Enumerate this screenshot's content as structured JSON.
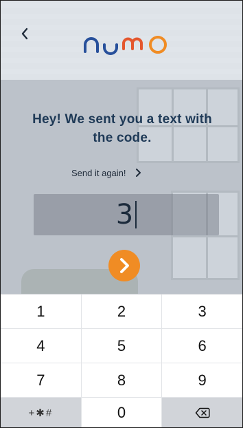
{
  "brand": {
    "logo_text": "numo",
    "colors": {
      "primary": "#1f3a57",
      "accent": "#f08c24",
      "logo_blue": "#27509b"
    }
  },
  "nav": {
    "back_icon": "chevron-left-icon"
  },
  "verification": {
    "headline": "Hey! We sent you a text with the code.",
    "resend_label": "Send it again!",
    "code_value": "3",
    "submit_icon": "chevron-right-icon"
  },
  "keypad": {
    "rows": [
      [
        "1",
        "2",
        "3"
      ],
      [
        "4",
        "5",
        "6"
      ],
      [
        "7",
        "8",
        "9"
      ],
      [
        "+✱#",
        "0",
        "backspace-icon"
      ]
    ]
  }
}
